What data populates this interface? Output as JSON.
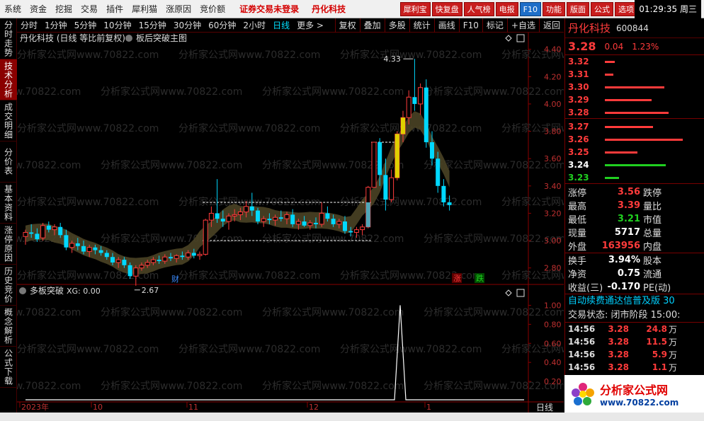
{
  "menubar": {
    "items": [
      "系统",
      "资金",
      "挖掘",
      "交易",
      "插件",
      "犀利猫",
      "涨原因",
      "竞价额"
    ],
    "warning": "证券交易未登录",
    "stock_name": "丹化科技",
    "toolbar_buttons": [
      "犀利宝",
      "快复盘",
      "人气榜",
      "电报",
      "F10",
      "功能",
      "版面",
      "公式",
      "选项"
    ],
    "clock": "01:29:35 周三"
  },
  "left_tabs": [
    "分时走势",
    "技术分析",
    "成交明细",
    "分价表",
    "基本资料",
    "涨停原因",
    "历史竞价",
    "概念解析",
    "公式下载"
  ],
  "left_tab_active": 1,
  "periods": [
    "分时",
    "1分钟",
    "5分钟",
    "10分钟",
    "15分钟",
    "30分钟",
    "60分钟",
    "2小时",
    "日线",
    "更多 >"
  ],
  "period_active": 8,
  "chart_buttons": [
    "复权",
    "叠加",
    "多股",
    "统计",
    "画线",
    "F10",
    "标记",
    "+自选",
    "返回"
  ],
  "chart": {
    "title": "丹化科技 (日线 等比前复权)",
    "formula": "板后突破主图",
    "sub_title": "多板突破",
    "sub_value": "XG: 0.00",
    "main_axis": [
      "4.40",
      "4.20",
      "4.00",
      "3.80",
      "3.60",
      "3.40",
      "3.20",
      "3.00",
      "2.80"
    ],
    "sub_axis": [
      "1.00",
      "0.80",
      "0.60",
      "0.40",
      "0.20"
    ],
    "date_axis": [
      "2023年",
      "10",
      "11",
      "12",
      "1"
    ],
    "period_label": "日线",
    "high_mark": "4.33",
    "low_mark": "2.67",
    "cai_mark": "财",
    "zhang_mark": "涨",
    "die_mark": "跌",
    "watermark": "分析家公式网www.70822.com"
  },
  "chart_data": {
    "type": "candlestick",
    "ylim": [
      2.7,
      4.45
    ],
    "candles": [
      [
        3.03,
        3.08,
        2.97,
        3.06
      ],
      [
        3.06,
        3.12,
        3.02,
        3.05
      ],
      [
        3.05,
        3.09,
        2.99,
        3.01
      ],
      [
        3.02,
        3.13,
        3.0,
        3.11
      ],
      [
        3.11,
        3.14,
        3.06,
        3.08
      ],
      [
        3.08,
        3.12,
        3.04,
        3.1
      ],
      [
        3.1,
        3.13,
        3.02,
        3.04
      ],
      [
        3.04,
        3.08,
        2.93,
        2.95
      ],
      [
        2.95,
        3.0,
        2.91,
        2.98
      ],
      [
        2.98,
        3.02,
        2.93,
        2.96
      ],
      [
        2.96,
        3.0,
        2.9,
        2.92
      ],
      [
        2.92,
        2.97,
        2.88,
        2.95
      ],
      [
        2.95,
        2.97,
        2.9,
        2.93
      ],
      [
        2.93,
        2.96,
        2.89,
        2.91
      ],
      [
        2.91,
        2.93,
        2.86,
        2.88
      ],
      [
        2.88,
        2.91,
        2.82,
        2.84
      ],
      [
        2.84,
        2.88,
        2.8,
        2.86
      ],
      [
        2.86,
        2.88,
        2.8,
        2.82
      ],
      [
        2.82,
        2.84,
        2.72,
        2.74
      ],
      [
        2.74,
        2.82,
        2.67,
        2.8
      ],
      [
        2.8,
        2.84,
        2.78,
        2.82
      ],
      [
        2.82,
        2.86,
        2.8,
        2.84
      ],
      [
        2.84,
        2.88,
        2.82,
        2.86
      ],
      [
        2.86,
        2.89,
        2.83,
        2.85
      ],
      [
        2.85,
        2.9,
        2.83,
        2.88
      ],
      [
        2.88,
        2.91,
        2.85,
        2.87
      ],
      [
        2.87,
        2.9,
        2.84,
        2.89
      ],
      [
        2.89,
        2.92,
        2.86,
        2.88
      ],
      [
        2.88,
        2.93,
        2.86,
        2.91
      ],
      [
        2.91,
        2.94,
        2.87,
        2.89
      ],
      [
        2.89,
        2.92,
        2.86,
        2.9
      ],
      [
        2.9,
        3.16,
        2.89,
        3.15
      ],
      [
        3.15,
        3.25,
        3.1,
        3.2
      ],
      [
        3.2,
        3.45,
        3.13,
        3.16
      ],
      [
        3.16,
        3.22,
        3.1,
        3.14
      ],
      [
        3.14,
        3.2,
        3.08,
        3.18
      ],
      [
        3.18,
        3.23,
        3.14,
        3.19
      ],
      [
        3.19,
        3.24,
        3.15,
        3.21
      ],
      [
        3.21,
        3.29,
        3.17,
        3.25
      ],
      [
        3.25,
        3.35,
        3.18,
        3.22
      ],
      [
        3.22,
        3.24,
        3.12,
        3.14
      ],
      [
        3.14,
        3.18,
        3.1,
        3.16
      ],
      [
        3.16,
        3.2,
        3.12,
        3.15
      ],
      [
        3.15,
        3.19,
        3.11,
        3.17
      ],
      [
        3.17,
        3.22,
        3.14,
        3.16
      ],
      [
        3.16,
        3.21,
        3.12,
        3.19
      ],
      [
        3.19,
        3.23,
        3.1,
        3.12
      ],
      [
        3.12,
        3.16,
        3.08,
        3.14
      ],
      [
        3.14,
        3.18,
        3.1,
        3.11
      ],
      [
        3.11,
        3.15,
        3.08,
        3.13
      ],
      [
        3.13,
        3.17,
        3.09,
        3.12
      ],
      [
        3.12,
        3.28,
        3.1,
        3.2
      ],
      [
        3.2,
        3.25,
        3.14,
        3.16
      ],
      [
        3.16,
        3.19,
        3.1,
        3.12
      ],
      [
        3.12,
        3.16,
        3.09,
        3.14
      ],
      [
        3.14,
        3.18,
        3.05,
        3.07
      ],
      [
        3.07,
        3.1,
        3.03,
        3.06
      ],
      [
        3.06,
        3.1,
        3.02,
        3.08
      ],
      [
        3.08,
        3.12,
        3.04,
        3.1
      ],
      [
        3.1,
        3.4,
        3.09,
        3.39
      ],
      [
        3.39,
        3.72,
        3.39,
        3.72
      ],
      [
        3.72,
        3.75,
        3.4,
        3.48
      ],
      [
        3.48,
        3.6,
        3.22,
        3.3
      ],
      [
        3.3,
        3.52,
        3.28,
        3.46
      ],
      [
        3.46,
        3.8,
        3.44,
        3.78
      ],
      [
        3.78,
        3.95,
        3.72,
        3.9
      ],
      [
        3.9,
        4.1,
        3.85,
        4.05
      ],
      [
        4.05,
        4.33,
        3.95,
        4.0
      ],
      [
        4.0,
        4.15,
        3.92,
        4.12
      ],
      [
        4.12,
        4.18,
        3.68,
        3.72
      ],
      [
        3.72,
        3.8,
        3.55,
        3.6
      ],
      [
        3.6,
        3.65,
        3.35,
        3.4
      ],
      [
        3.4,
        3.45,
        3.25,
        3.28
      ],
      [
        3.28,
        3.33,
        3.22,
        3.26
      ]
    ],
    "sub_series": {
      "name": "XG",
      "ylim": [
        0,
        1.1
      ],
      "spike_index": 65,
      "spike_value": 1.0
    }
  },
  "quote": {
    "name": "丹化科技",
    "code": "600844",
    "price": "3.28",
    "change": "0.04",
    "pct": "1.23%"
  },
  "asks": [
    {
      "p": "3.32",
      "w": 14
    },
    {
      "p": "3.31",
      "w": 12
    },
    {
      "p": "3.30",
      "w": 84
    },
    {
      "p": "3.29",
      "w": 66
    },
    {
      "p": "3.28",
      "w": 90
    }
  ],
  "bids": [
    {
      "p": "3.27",
      "w": 68,
      "c": "#ff3b3b"
    },
    {
      "p": "3.26",
      "w": 110,
      "c": "#ff3b3b"
    },
    {
      "p": "3.25",
      "w": 46,
      "c": "#ff3b3b"
    },
    {
      "p": "3.24",
      "w": 86,
      "c": "#20d020"
    },
    {
      "p": "3.23",
      "w": 20,
      "c": "#20d020"
    }
  ],
  "stats": [
    {
      "k": "涨停",
      "v": "3.56",
      "vc": "#ff3b3b",
      "k2": "跌停"
    },
    {
      "k": "最高",
      "v": "3.39",
      "vc": "#ff3b3b",
      "k2": "量比"
    },
    {
      "k": "最低",
      "v": "3.21",
      "vc": "#20d020",
      "k2": "市值"
    },
    {
      "k": "现量",
      "v": "5717",
      "vc": "#ffffff",
      "k2": "总量"
    },
    {
      "k": "外盘",
      "v": "163956",
      "vc": "#ff3b3b",
      "k2": "内盘"
    }
  ],
  "fin": [
    {
      "k": "换手",
      "v": "3.94%",
      "k2": "股本"
    },
    {
      "k": "净资",
      "v": "0.75",
      "k2": "流通"
    },
    {
      "k": "收益(三)",
      "v": "-0.170",
      "k2": "PE(动)"
    }
  ],
  "notice": "自动续费通达信普及版 30",
  "status": "交易状态: 闭市阶段 15:00:",
  "ticks": [
    {
      "t": "14:56",
      "p": "3.28",
      "v": "24.8",
      "u": "万"
    },
    {
      "t": "14:56",
      "p": "3.28",
      "v": "11.5",
      "u": "万"
    },
    {
      "t": "14:56",
      "p": "3.28",
      "v": "5.9",
      "u": "万"
    },
    {
      "t": "14:56",
      "p": "3.28",
      "v": "1.1",
      "u": "万"
    }
  ],
  "logo": {
    "line1": "分析家公式网",
    "line2": "www.70822.com"
  }
}
